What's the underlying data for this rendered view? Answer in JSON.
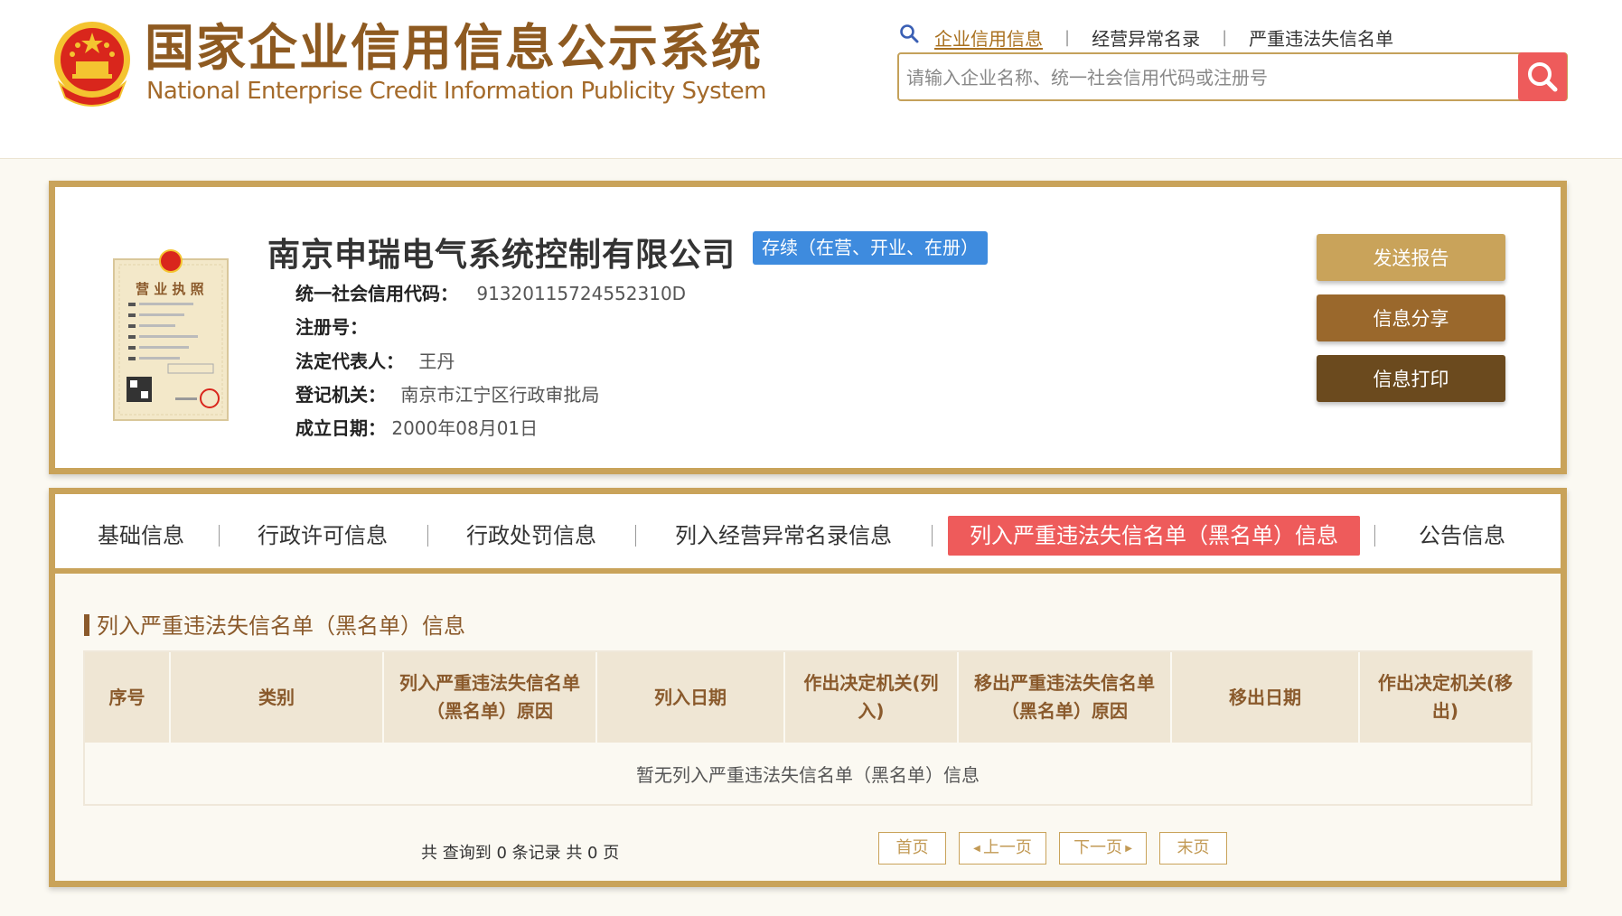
{
  "header": {
    "title_cn": "国家企业信用信息公示系统",
    "title_en": "National Enterprise Credit Information Publicity System",
    "search_tabs": [
      "企业信用信息",
      "经营异常名录",
      "严重违法失信名单"
    ],
    "search_placeholder": "请输入企业名称、统一社会信用代码或注册号"
  },
  "company": {
    "name": "南京申瑞电气系统控制有限公司",
    "status": "存续（在营、开业、在册）",
    "fields": {
      "credit_code_label": "统一社会信用代码：",
      "credit_code": "91320115724552310D",
      "reg_no_label": "注册号：",
      "reg_no": "",
      "legal_rep_label": "法定代表人：",
      "legal_rep": "王丹",
      "authority_label": "登记机关：",
      "authority": "南京市江宁区行政审批局",
      "founded_label": "成立日期：",
      "founded": "2000年08月01日"
    },
    "actions": [
      "发送报告",
      "信息分享",
      "信息打印"
    ],
    "license_text": "营 业 执 照"
  },
  "tabs": {
    "items": [
      "基础信息",
      "行政许可信息",
      "行政处罚信息",
      "列入经营异常名录信息",
      "列入严重违法失信名单（黑名单）信息",
      "公告信息"
    ],
    "active_index": 4
  },
  "section": {
    "title": "列入严重违法失信名单（黑名单）信息",
    "columns": [
      "序号",
      "类别",
      "列入严重违法失信名单（黑名单）原因",
      "列入日期",
      "作出决定机关(列入)",
      "移出严重违法失信名单（黑名单）原因",
      "移出日期",
      "作出决定机关(移出)"
    ],
    "empty_text": "暂无列入严重违法失信名单（黑名单）信息"
  },
  "pagination": {
    "summary": "共 查询到 0 条记录 共 0 页",
    "first": "首页",
    "prev": "上一页",
    "next": "下一页",
    "last": "末页"
  },
  "colors": {
    "gold": "#c9a35a",
    "brown": "#8b5a2b",
    "red": "#ee5b5b",
    "blue": "#3e8bde"
  }
}
